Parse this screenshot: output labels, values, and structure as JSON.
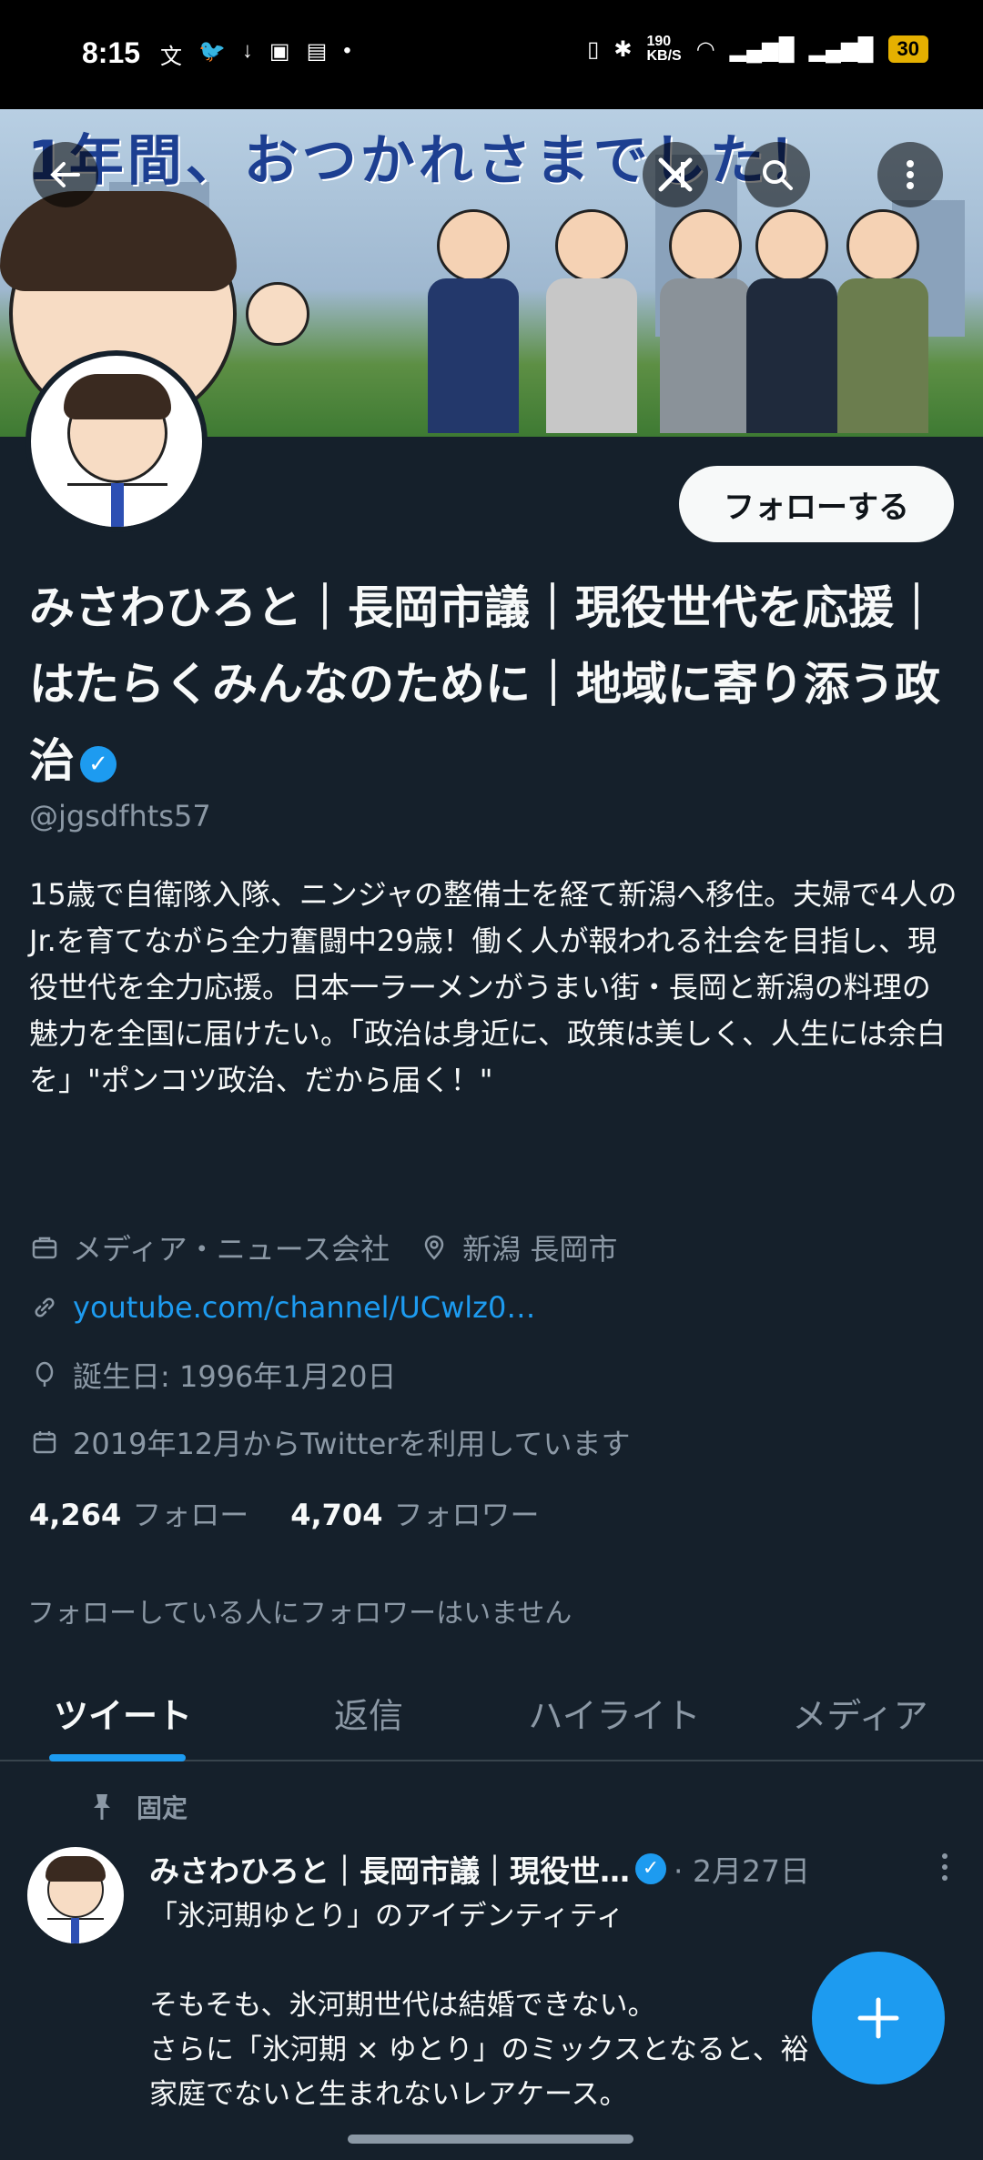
{
  "status_bar": {
    "time": "8:15",
    "network_speed": "190\nKB/S",
    "battery": "30"
  },
  "banner": {
    "title": "1年間、おつかれさまでした！"
  },
  "profile": {
    "follow_label": "フォローする",
    "name": "みさわひろと｜長岡市議｜現役世代を応援｜はたらくみんなのために｜地域に寄り添う政治",
    "handle": "@jgsdfhts57",
    "bio": "15歳で自衛隊入隊、ニンジャの整備士を経て新潟へ移住。夫婦で4人のJr.を育てながら全力奮闘中29歳！働く人が報われる社会を目指し、現役世代を全力応援。日本一ラーメンがうまい街・長岡と新潟の料理の魅力を全国に届けたい。「政治は身近に、政策は美しく、人生には余白を」\"ポンコツ政治、だから届く！\"",
    "category": "メディア・ニュース会社",
    "location": "新潟 長岡市",
    "link": "youtube.com/channel/UCwlz0…",
    "birthday": "誕生日: 1996年1月20日",
    "joined": "2019年12月からTwitterを利用しています",
    "following_count": "4,264",
    "following_label": "フォロー",
    "followers_count": "4,704",
    "followers_label": "フォロワー",
    "mutual_note": "フォローしている人にフォロワーはいません"
  },
  "tabs": [
    {
      "label": "ツイート"
    },
    {
      "label": "返信"
    },
    {
      "label": "ハイライト"
    },
    {
      "label": "メディア"
    }
  ],
  "tweet": {
    "pinned_label": "固定",
    "author": "みさわひろと｜長岡市議｜現役世…",
    "date": "· 2月27日",
    "body": "「氷河期ゆとり」のアイデンティティ\n\nそもそも、氷河期世代は結婚できない。\nさらに「氷河期 × ゆとり」のミックスとなると、裕\n家庭でないと生まれないレアケース。"
  },
  "colors": {
    "background": "#15202b",
    "accent": "#1d9bf0",
    "secondary_text": "#8b98a5"
  }
}
